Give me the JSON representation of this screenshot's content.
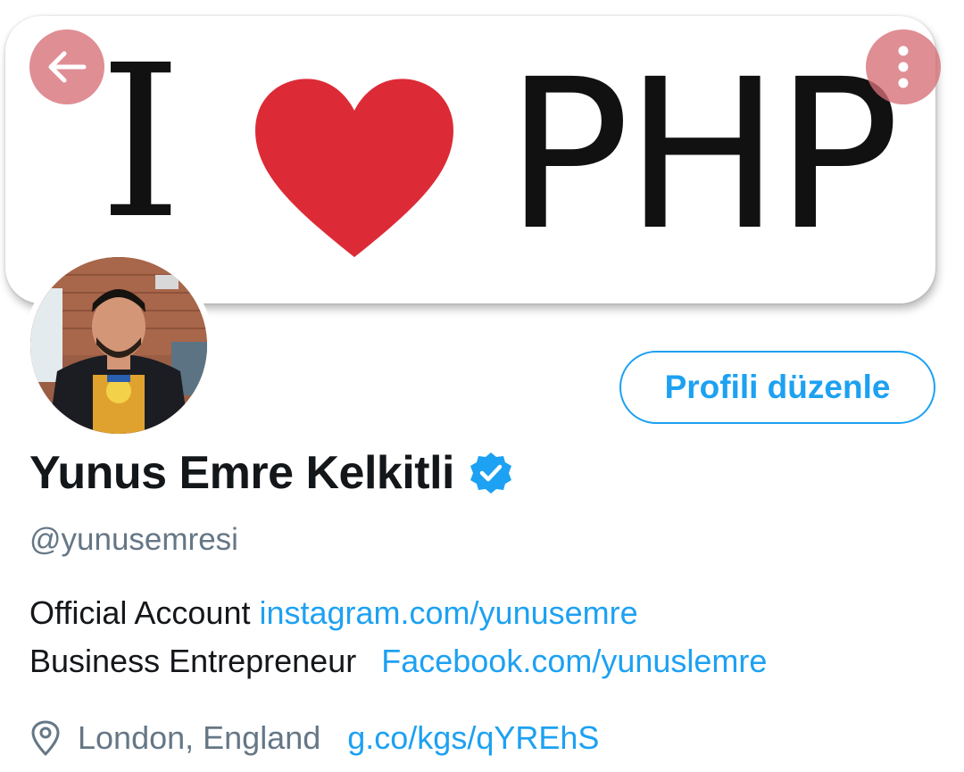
{
  "banner": {
    "text_left": "I",
    "text_right": "PHP",
    "heart_color": "#DC2B37"
  },
  "header": {
    "back_icon": "arrow-left-icon",
    "more_icon": "more-vertical-icon"
  },
  "profile": {
    "edit_button_label": "Profili düzenle",
    "name": "Yunus Emre Kelkitli",
    "verified_icon": "verified-badge-icon",
    "handle": "@yunusemresi",
    "bio": {
      "line1_text": "Official Account ",
      "line1_link": "instagram.com/yunusemre",
      "line2_text": "Business Entrepreneur ",
      "line2_link": "Facebook.com/yunuslemre"
    },
    "location": "London, England",
    "location_icon": "location-pin-icon",
    "website": "g.co/kgs/qYREhS"
  },
  "colors": {
    "accent": "#1DA1F2",
    "text_primary": "#14171A",
    "text_secondary": "#657786",
    "button_overlay": "#D66E76"
  }
}
